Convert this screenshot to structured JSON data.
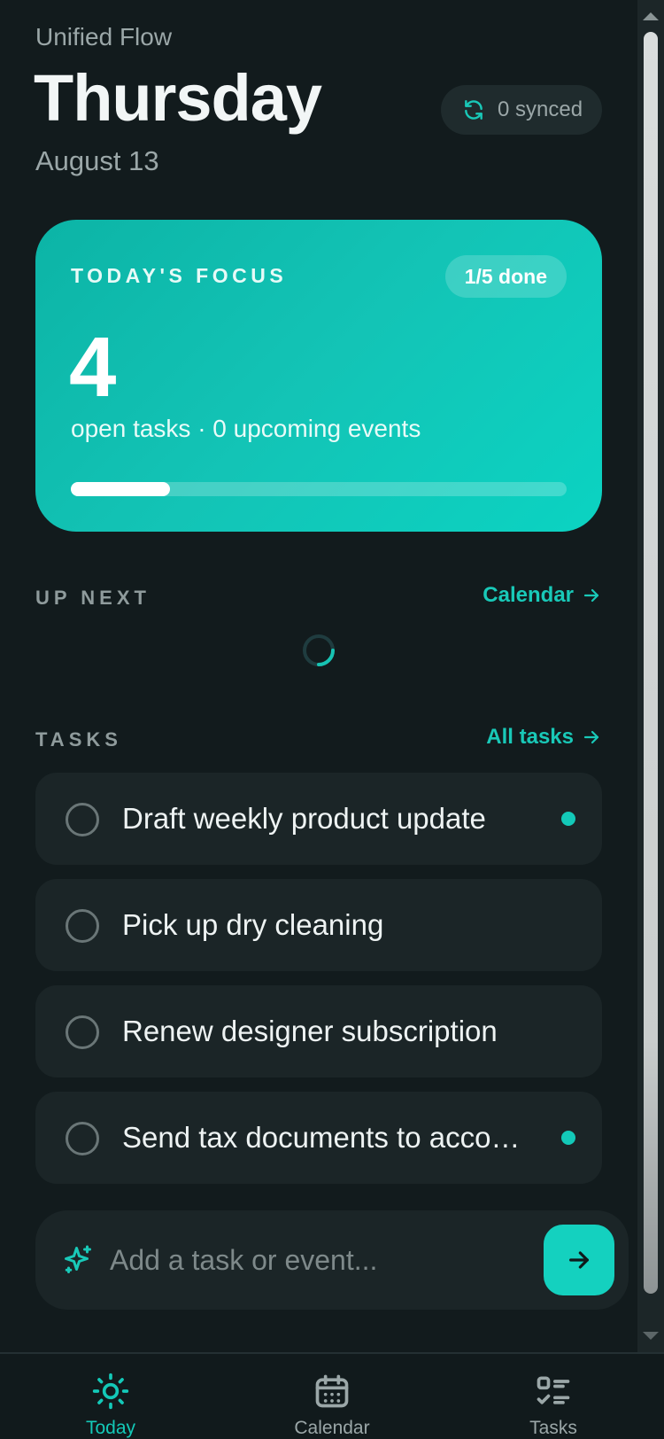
{
  "header": {
    "app_name": "Unified Flow",
    "day": "Thursday",
    "date": "August 13",
    "sync_label": "0 synced"
  },
  "focus": {
    "label": "TODAY'S FOCUS",
    "badge": "1/5 done",
    "count": "4",
    "subtitle": "open tasks · 0 upcoming events",
    "progress": 0.2
  },
  "up_next": {
    "label": "UP NEXT",
    "link": "Calendar"
  },
  "tasks_section": {
    "label": "TASKS",
    "link": "All tasks"
  },
  "tasks": [
    {
      "title": "Draft weekly product update",
      "flagged": true
    },
    {
      "title": "Pick up dry cleaning",
      "flagged": false
    },
    {
      "title": "Renew designer subscription",
      "flagged": false
    },
    {
      "title": "Send tax documents to accountant",
      "flagged": true
    }
  ],
  "composer": {
    "placeholder": "Add a task or event..."
  },
  "nav": {
    "today": "Today",
    "calendar": "Calendar",
    "tasks": "Tasks"
  },
  "colors": {
    "accent": "#13c9b8",
    "background": "#121b1d",
    "card": "#1b2527"
  }
}
